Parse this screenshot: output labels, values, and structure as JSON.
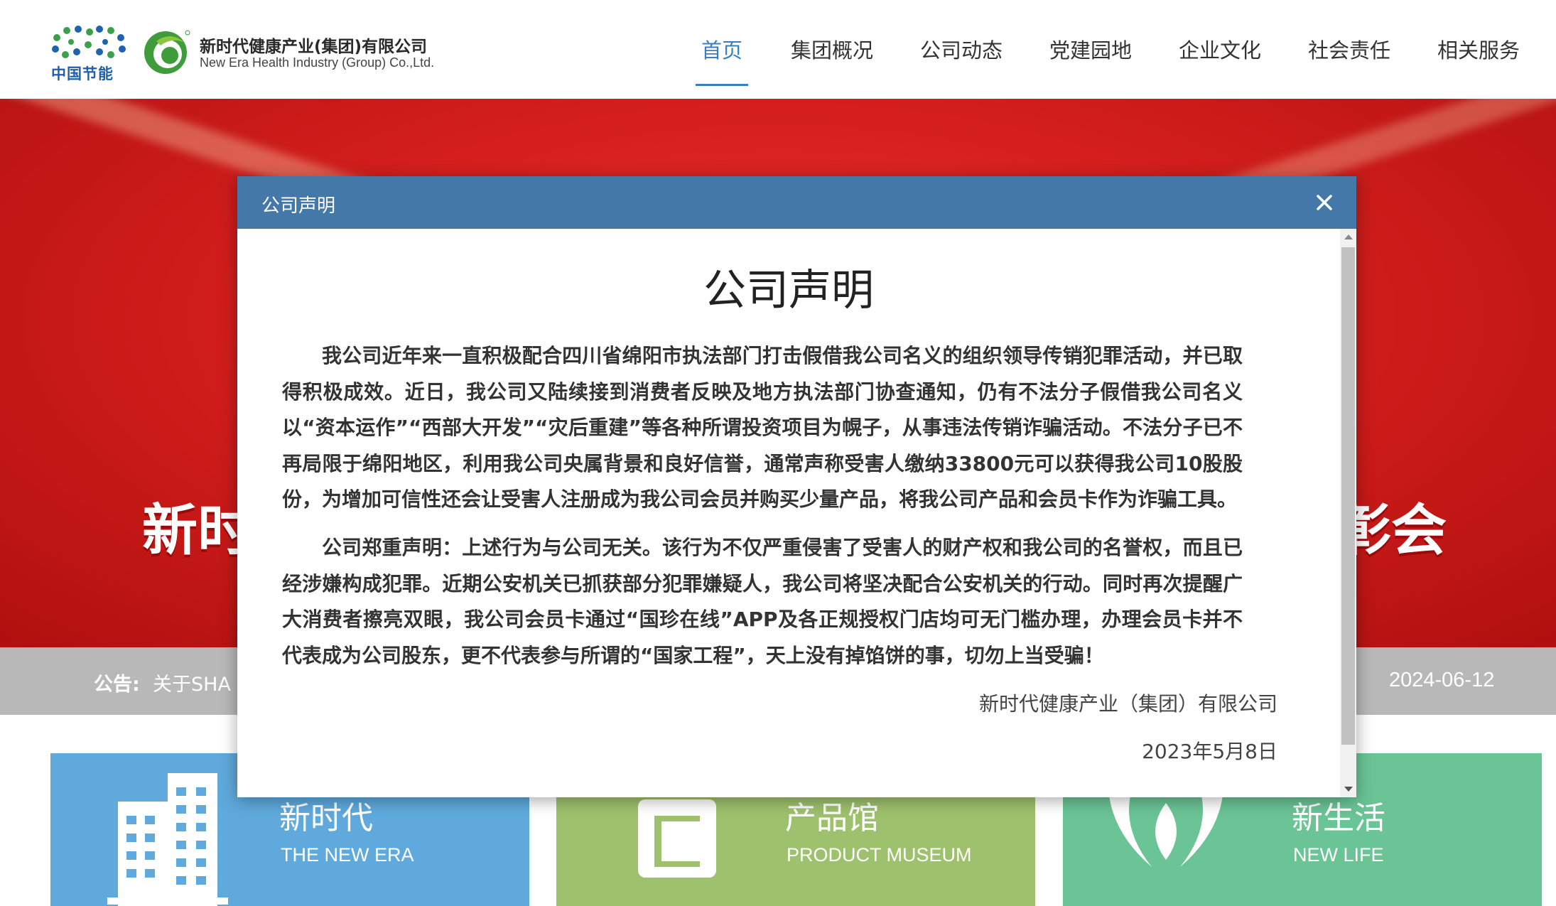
{
  "header": {
    "cecep_logo_text": "中国节能",
    "company_name_cn": "新时代健康产业(集团)有限公司",
    "company_name_en": "New Era Health Industry (Group) Co.,Ltd."
  },
  "nav": {
    "items": [
      {
        "label": "首页",
        "active": true
      },
      {
        "label": "集团概况"
      },
      {
        "label": "公司动态"
      },
      {
        "label": "党建园地"
      },
      {
        "label": "企业文化"
      },
      {
        "label": "社会责任"
      },
      {
        "label": "相关服务"
      }
    ],
    "active_color": "#3a7ec0"
  },
  "banner": {
    "left_text": "新时",
    "right_text": "彰会"
  },
  "notice": {
    "label": "公告:",
    "text": "关于SHA",
    "date": "2024-06-12"
  },
  "cards": [
    {
      "title": "新时代",
      "subtitle": "THE NEW ERA",
      "color": "#5fa9dc"
    },
    {
      "title": "产品馆",
      "subtitle": "PRODUCT MUSEUM",
      "color": "#9ec16d"
    },
    {
      "title": "新生活",
      "subtitle": "NEW LIFE",
      "color": "#6ac495"
    }
  ],
  "modal": {
    "header_title": "公司声明",
    "header_color": "#4378a8",
    "doc_title": "公司声明",
    "paragraph1": "我公司近年来一直积极配合四川省绵阳市执法部门打击假借我公司名义的组织领导传销犯罪活动，并已取得积极成效。近日，我公司又陆续接到消费者反映及地方执法部门协查通知，仍有不法分子假借我公司名义以“资本运作”“西部大开发”“灾后重建”等各种所谓投资项目为幌子，从事违法传销诈骗活动。不法分子已不再局限于绵阳地区，利用我公司央属背景和良好信誉，通常声称受害人缴纳33800元可以获得我公司10股股份，为增加可信性还会让受害人注册成为我公司会员并购买少量产品，将我公司产品和会员卡作为诈骗工具。",
    "paragraph2": "公司郑重声明：上述行为与公司无关。该行为不仅严重侵害了受害人的财产权和我公司的名誉权，而且已经涉嫌构成犯罪。近期公安机关已抓获部分犯罪嫌疑人，我公司将坚决配合公安机关的行动。同时再次提醒广大消费者擦亮双眼，我公司会员卡通过“国珍在线”APP及各正规授权门店均可无门槛办理，办理会员卡并不代表成为公司股东，更不代表参与所谓的“国家工程”，天上没有掉馅饼的事，切勿上当受骗！",
    "signature": "新时代健康产业（集团）有限公司",
    "date": "2023年5月8日"
  }
}
